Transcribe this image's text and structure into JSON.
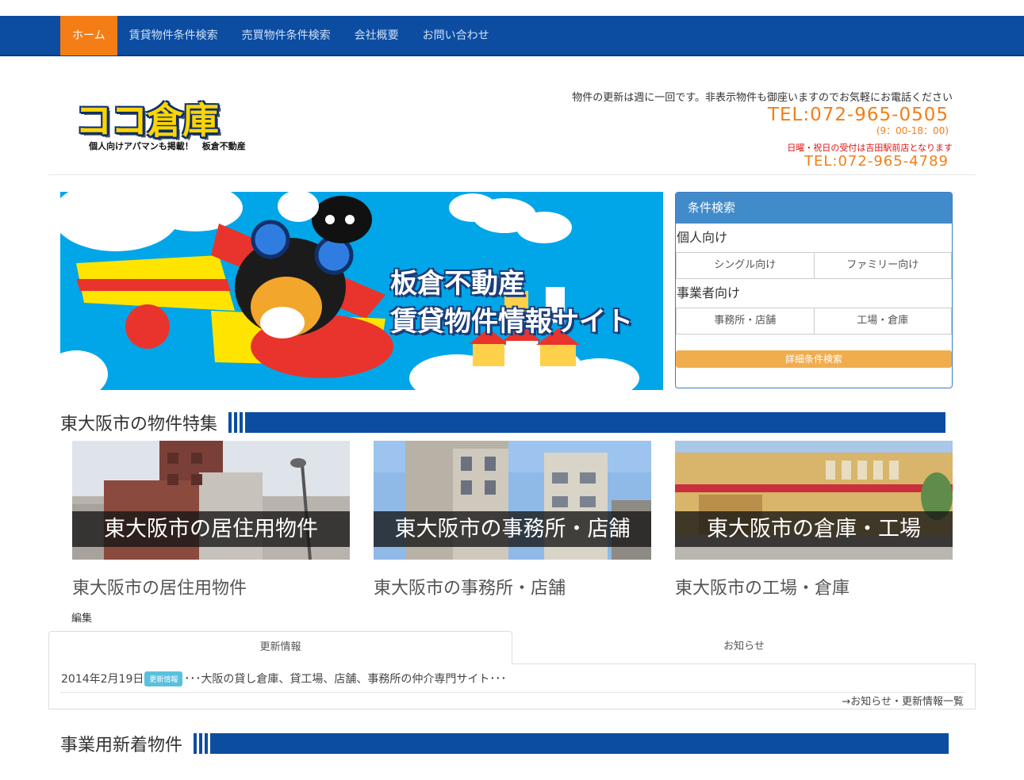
{
  "nav": {
    "items": [
      "ホーム",
      "賃貸物件条件検索",
      "売買物件条件検索",
      "会社概要",
      "お問い合わせ"
    ]
  },
  "header": {
    "logo_text": "ココ倉庫",
    "logo_sub": "個人向けアパマンも掲載！　板倉不動産",
    "note": "物件の更新は週に一回です。非表示物件も御座いますのでお気軽にお電話ください",
    "tel": "TEL:072-965-0505",
    "hours": "(9：00-18：00)",
    "note2": "日曜・祝日の受付は吉田駅前店となります",
    "tel2": "TEL:072-965-4789"
  },
  "banner": {
    "line1": "板倉不動産",
    "line2": "賃貸物件情報サイト"
  },
  "search": {
    "title": "条件検索",
    "personal_label": "個人向け",
    "single": "シングル向け",
    "family": "ファミリー向け",
    "business_label": "事業者向け",
    "office": "事務所・店舗",
    "factory": "工場・倉庫",
    "detail": "詳細条件検索"
  },
  "feature": {
    "title": "東大阪市の物件特集",
    "cards": [
      {
        "overlay": "東大阪市の居住用物件",
        "caption": "東大阪市の居住用物件"
      },
      {
        "overlay": "東大阪市の事務所・店舗",
        "caption": "東大阪市の事務所・店舗"
      },
      {
        "overlay": "東大阪市の倉庫・工場",
        "caption": "東大阪市の工場・倉庫"
      }
    ],
    "edit": "編集"
  },
  "news": {
    "tab_updates": "更新情報",
    "tab_notices": "お知らせ",
    "date": "2014年2月19日",
    "badge": "更新情報",
    "text": "･･･大阪の貸し倉庫、貸工場、店舗、事務所の仲介専門サイト･･･",
    "more": "→お知らせ・更新情報一覧"
  },
  "business": {
    "title": "事業用新着物件"
  },
  "colors": {
    "nav_blue": "#0c4da2",
    "active_orange": "#f47e15",
    "panel_blue": "#428bca",
    "detail_orange": "#f0ad4e"
  }
}
